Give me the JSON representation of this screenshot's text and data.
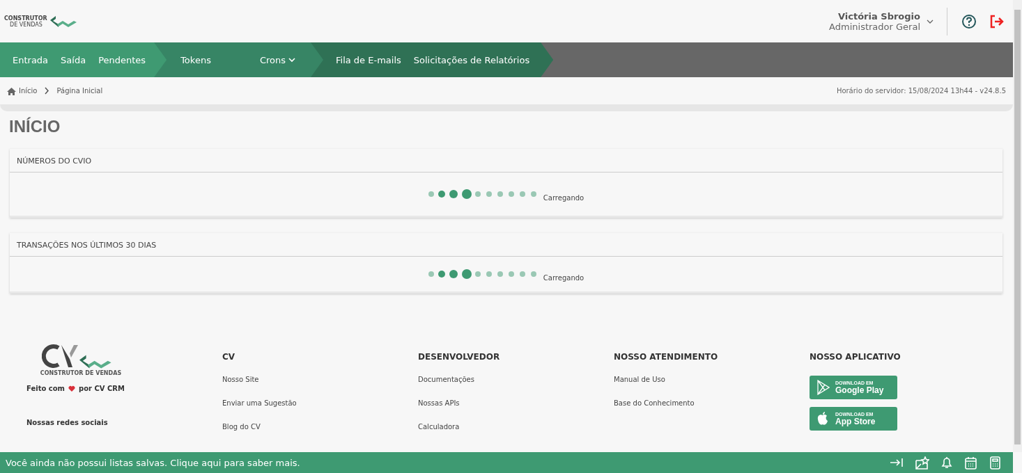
{
  "header": {
    "logo_text": [
      "CONSTRUTOR",
      "DE VENDAS"
    ],
    "user_name": "Victória Sbrogio",
    "user_role": "Administrador Geral"
  },
  "nav": {
    "groups": [
      {
        "items": [
          {
            "label": "Entrada",
            "dropdown": false
          },
          {
            "label": "Saída",
            "dropdown": false
          },
          {
            "label": "Pendentes",
            "dropdown": false
          }
        ]
      },
      {
        "items": [
          {
            "label": "Tokens",
            "dropdown": false
          },
          {
            "label": "Crons",
            "dropdown": true
          }
        ]
      },
      {
        "items": [
          {
            "label": "Fila de E-mails",
            "dropdown": false
          },
          {
            "label": "Solicitações de Relatórios",
            "dropdown": false
          }
        ]
      }
    ]
  },
  "breadcrumb": [
    "Início",
    "Página Inicial"
  ],
  "server_info": "Horário do servidor: 15/08/2024 13h44 - v24.8.5",
  "page_title": "INÍCIO",
  "panels": [
    {
      "title": "NÚMEROS DO CVIO",
      "status": "Carregando"
    },
    {
      "title": "TRANSAÇÕES NOS ÚLTIMOS 30 DIAS",
      "status": "Carregando"
    }
  ],
  "footer": {
    "logo_caption": "CONSTRUTOR DE VENDAS",
    "made_with": [
      "Feito com",
      "por CV CRM"
    ],
    "social_title": "Nossas redes sociais",
    "columns": [
      {
        "title": "CV",
        "links": [
          "Nosso Site",
          "Enviar uma Sugestão",
          "Blog do CV"
        ]
      },
      {
        "title": "DESENVOLVEDOR",
        "links": [
          "Documentações",
          "Nossas APIs",
          "Calculadora"
        ]
      },
      {
        "title": "NOSSO ATENDIMENTO",
        "links": [
          "Manual de Uso",
          "Base do Conhecimento"
        ]
      }
    ],
    "app_title": "NOSSO APLICATIVO",
    "app_buttons": [
      {
        "kind": "google",
        "small": "DOWNLOAD EM",
        "big": "Google Play"
      },
      {
        "kind": "apple",
        "small": "DOWNLOAD EM",
        "big": "App Store"
      }
    ]
  },
  "bottom_bar": {
    "message": "Você ainda não possui listas salvas. Clique aqui para saber mais."
  }
}
